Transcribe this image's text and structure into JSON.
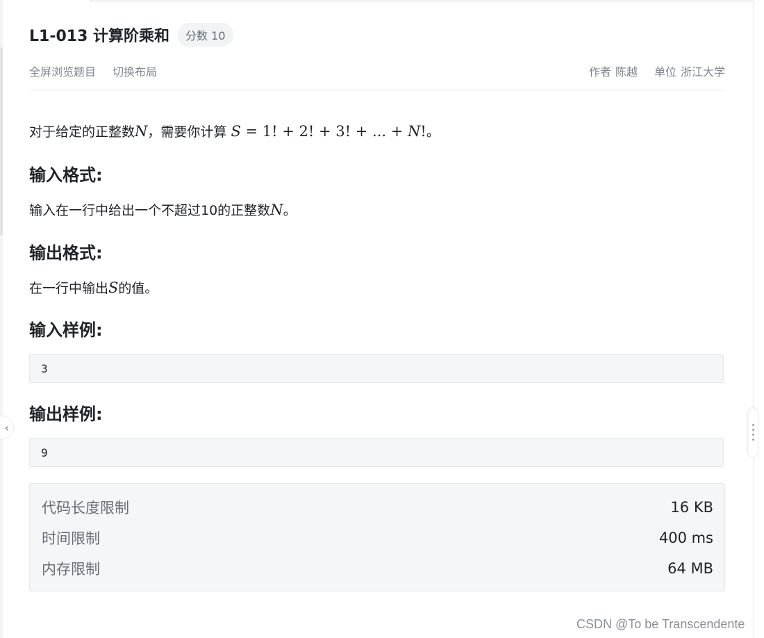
{
  "problem": {
    "title": "L1-013 计算阶乘和",
    "score_badge": "分数 10",
    "nav": {
      "fullscreen_link": "全屏浏览题目",
      "layout_link": "切换布局"
    },
    "author_label": "作者",
    "author_name": "陈越",
    "unit_label": "单位",
    "unit_name": "浙江大学"
  },
  "statement": {
    "intro_prefix": "对于给定的正整数",
    "intro_var": "N",
    "intro_mid": "，需要你计算 ",
    "formula_S": "S",
    "formula_rhs": " = 1! + 2! + 3! + ... + ",
    "formula_N": "N",
    "formula_tail": "!",
    "intro_end": "。",
    "input_heading": "输入格式:",
    "input_text_prefix": "输入在一行中给出一个不超过10的正整数",
    "input_var": "N",
    "input_text_end": "。",
    "output_heading": "输出格式:",
    "output_text_prefix": "在一行中输出",
    "output_var": "S",
    "output_text_end": "的值。",
    "sample_input_heading": "输入样例:",
    "sample_input": "3",
    "sample_output_heading": "输出样例:",
    "sample_output": "9"
  },
  "limits": [
    {
      "label": "代码长度限制",
      "value": "16 KB"
    },
    {
      "label": "时间限制",
      "value": "400 ms"
    },
    {
      "label": "内存限制",
      "value": "64 MB"
    }
  ],
  "watermark": "CSDN @To be Transcendente",
  "icons": {
    "collapse": "chevron-left-icon",
    "resize": "drag-handle-icon"
  }
}
